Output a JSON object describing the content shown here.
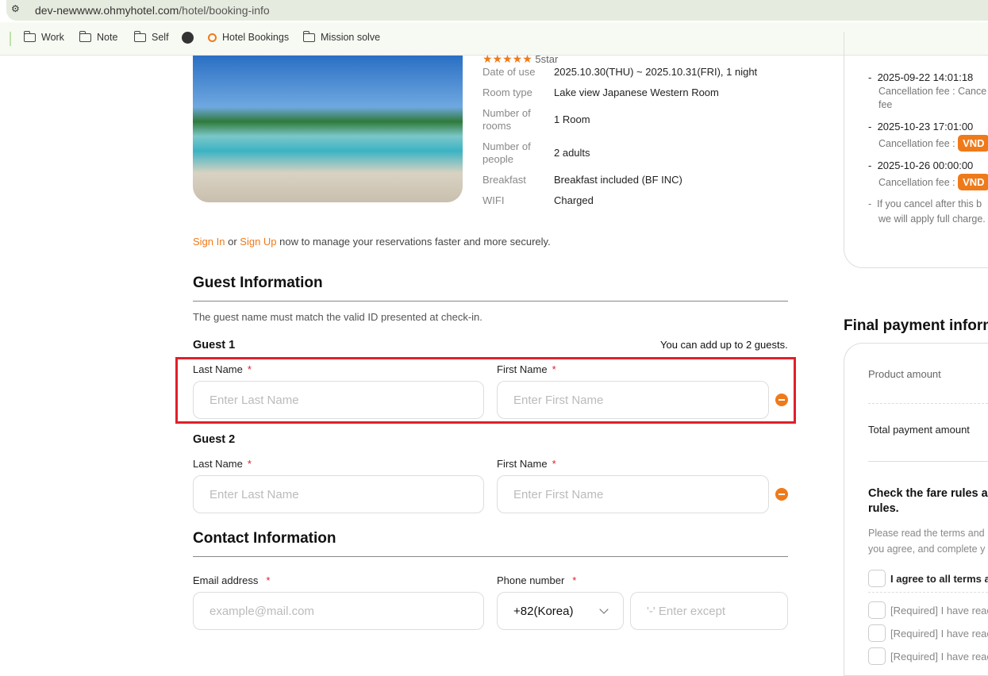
{
  "browser": {
    "url_host": "dev-newwww.ohmyhotel.com",
    "url_path": "/hotel/booking-info",
    "bookmarks": [
      "Work",
      "Note",
      "Self",
      "Hotel Bookings",
      "Mission solve"
    ]
  },
  "hotel": {
    "rating": "5star",
    "details": [
      {
        "label": "Date of use",
        "value": "2025.10.30(THU) ~ 2025.10.31(FRI), 1 night"
      },
      {
        "label": "Room type",
        "value": "Lake view Japanese Western Room"
      },
      {
        "label": "Number of rooms",
        "value": "1 Room"
      },
      {
        "label": "Number of people",
        "value": "2 adults"
      },
      {
        "label": "Breakfast",
        "value": "Breakfast included (BF INC)"
      },
      {
        "label": "WIFI",
        "value": "Charged"
      }
    ]
  },
  "signin": {
    "sign_in": "Sign In",
    "or": " or ",
    "sign_up": "Sign Up",
    "rest": " now to manage your reservations faster and more securely."
  },
  "guest": {
    "title": "Guest Information",
    "note": "The guest name must match the valid ID presented at check-in.",
    "max_note": "You can add up to 2 guests.",
    "guests": [
      {
        "label": "Guest 1"
      },
      {
        "label": "Guest 2"
      }
    ],
    "last_name_label": "Last Name",
    "first_name_label": "First Name",
    "last_name_placeholder": "Enter Last Name",
    "first_name_placeholder": "Enter First Name",
    "required": "*"
  },
  "contact": {
    "title": "Contact Information",
    "email_label": "Email address",
    "email_placeholder": "example@mail.com",
    "phone_label": "Phone number",
    "country_code": "+82(Korea)",
    "phone_placeholder": "'-' Enter except"
  },
  "cancellation": {
    "items": [
      {
        "date": "2025-09-22 14:01:18",
        "fee_label": "Cancellation fee : ",
        "fee": "Cance",
        "fee2": "fee"
      },
      {
        "date": "2025-10-23 17:01:00",
        "fee_label": "Cancellation fee : ",
        "badge": "VND"
      },
      {
        "date": "2025-10-26 00:00:00",
        "fee_label": "Cancellation fee : ",
        "badge": "VND"
      }
    ],
    "note1": "If you cancel after this b",
    "note2": "we will apply full charge."
  },
  "payment": {
    "title": "Final payment inform",
    "product_amount": "Product amount",
    "total_amount": "Total payment amount",
    "rules_title1": "Check the fare rules a",
    "rules_title2": "rules.",
    "rules_desc1": "Please read the terms and",
    "rules_desc2": "you agree, and complete y",
    "agree_all": "I agree to all terms ar",
    "required_items": [
      "[Required] I have reac",
      "[Required] I have reac",
      "[Required] I have reac"
    ]
  },
  "colors": {
    "accent": "#ef7a1a",
    "highlight": "#e0202a"
  }
}
